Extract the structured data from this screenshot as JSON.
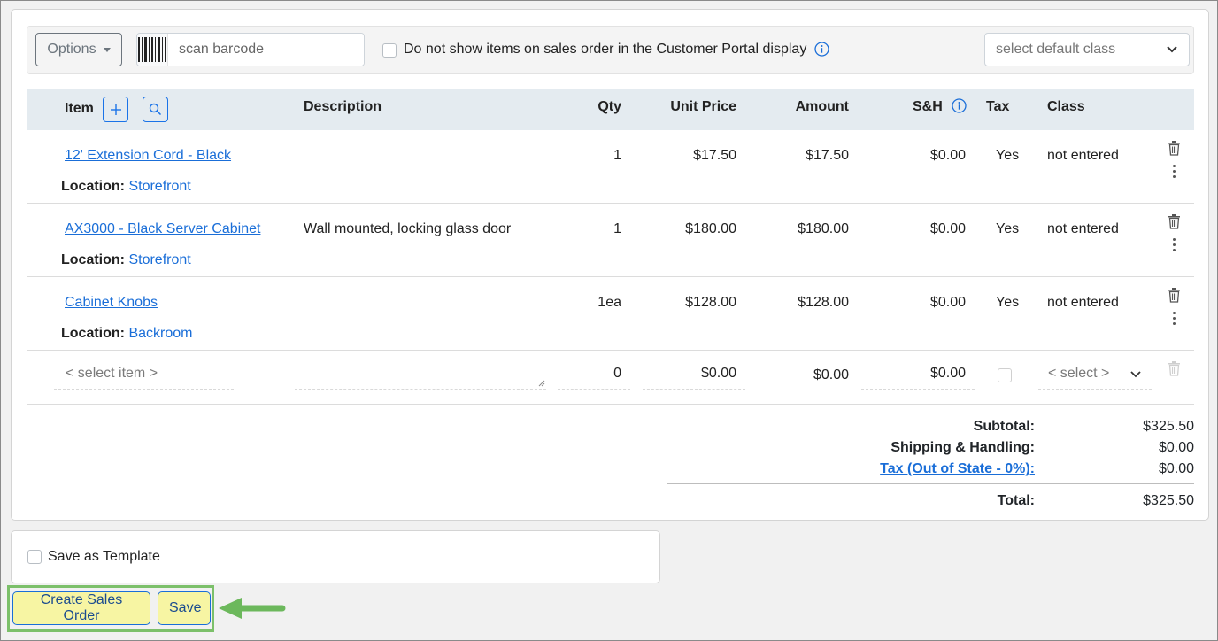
{
  "toolbar": {
    "options_label": "Options",
    "scan_placeholder": "scan barcode",
    "portal_checkbox_label": "Do not show items on sales order in the Customer Portal display",
    "default_class_placeholder": "select default class"
  },
  "table": {
    "headers": {
      "item": "Item",
      "description": "Description",
      "qty": "Qty",
      "unit_price": "Unit Price",
      "amount": "Amount",
      "sh": "S&H",
      "tax": "Tax",
      "class": "Class"
    },
    "location_label": "Location:",
    "rows": [
      {
        "item": "12' Extension Cord - Black",
        "description": "",
        "qty": "1",
        "unit_price": "$17.50",
        "amount": "$17.50",
        "sh": "$0.00",
        "tax": "Yes",
        "class": "not entered",
        "location": "Storefront"
      },
      {
        "item": "AX3000 - Black Server Cabinet",
        "description": "Wall mounted, locking glass door",
        "qty": "1",
        "unit_price": "$180.00",
        "amount": "$180.00",
        "sh": "$0.00",
        "tax": "Yes",
        "class": "not entered",
        "location": "Storefront"
      },
      {
        "item": "Cabinet Knobs",
        "description": "",
        "qty": "1ea",
        "unit_price": "$128.00",
        "amount": "$128.00",
        "sh": "$0.00",
        "tax": "Yes",
        "class": "not entered",
        "location": "Backroom"
      }
    ],
    "new_row": {
      "item_placeholder": "< select item >",
      "qty": "0",
      "unit_price": "$0.00",
      "amount": "$0.00",
      "sh": "$0.00",
      "class_placeholder": "< select >"
    }
  },
  "totals": {
    "subtotal_label": "Subtotal:",
    "subtotal": "$325.50",
    "shipping_label": "Shipping & Handling:",
    "shipping": "$0.00",
    "tax_label": "Tax (Out of State - 0%):",
    "tax": "$0.00",
    "total_label": "Total:",
    "total": "$325.50"
  },
  "save_template_label": "Save as Template",
  "actions": {
    "create_label": "Create Sales Order",
    "save_label": "Save"
  },
  "colors": {
    "link": "#1a6ed8",
    "header_bg": "#e4ebf0",
    "button_bg": "#f7f5a3",
    "highlight": "#7cc06a"
  }
}
